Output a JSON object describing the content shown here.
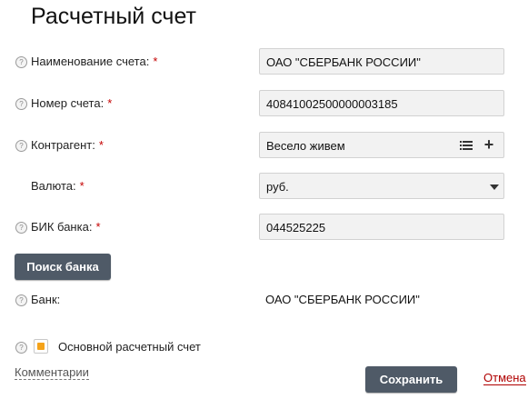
{
  "page": {
    "title": "Расчетный счет"
  },
  "help_glyph": "?",
  "required_marker": "*",
  "form": {
    "account_name": {
      "label": "Наименование счета:",
      "value": "ОАО \"СБЕРБАНК РОССИИ\""
    },
    "account_number": {
      "label": "Номер счета:",
      "value": "40841002500000003185"
    },
    "counterparty": {
      "label": "Контрагент:",
      "value": "Весело живем",
      "add_icon_glyph": "+"
    },
    "currency": {
      "label": "Валюта:",
      "value": "руб."
    },
    "bik": {
      "label": "БИК банка:",
      "value": "044525225"
    }
  },
  "actions": {
    "search_bank_label": "Поиск банка",
    "save_label": "Сохранить",
    "cancel_label": "Отмена",
    "comments_label": "Комментарии"
  },
  "bank": {
    "label": "Банк:",
    "value": "ОАО \"СБЕРБАНК РОССИИ\""
  },
  "primary_account": {
    "label": "Основной расчетный счет",
    "checked": true
  },
  "colors": {
    "button_bg": "#4f5a67",
    "required": "#c40000",
    "checkbox_accent": "#f5a31a",
    "cancel_link": "#b00000"
  },
  "icons": {
    "help": "question-circle-icon",
    "list": "list-icon",
    "add": "plus-icon",
    "dropdown": "chevron-down-icon"
  }
}
